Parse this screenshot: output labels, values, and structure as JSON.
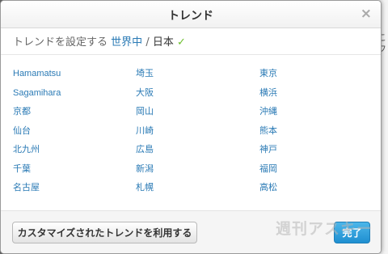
{
  "dialog": {
    "title": "トレンド",
    "close_label": "×"
  },
  "breadcrumb": {
    "prefix": "トレンドを設定する",
    "world": "世界中",
    "separator": "/",
    "current": "日本",
    "check": "✓"
  },
  "locations": [
    [
      "Hamamatsu",
      "埼玉",
      "東京"
    ],
    [
      "Sagamihara",
      "大阪",
      "横浜"
    ],
    [
      "京都",
      "岡山",
      "沖縄"
    ],
    [
      "仙台",
      "川崎",
      "熊本"
    ],
    [
      "北九州",
      "広島",
      "神戸"
    ],
    [
      "千葉",
      "新潟",
      "福岡"
    ],
    [
      "名古屋",
      "札幌",
      "高松"
    ]
  ],
  "footer": {
    "custom_button": "カスタマイズされたトレンドを利用する",
    "done_button": "完了"
  },
  "watermark": "週刊アスキー",
  "background_snippets": [
    "こ",
    "フ"
  ]
}
